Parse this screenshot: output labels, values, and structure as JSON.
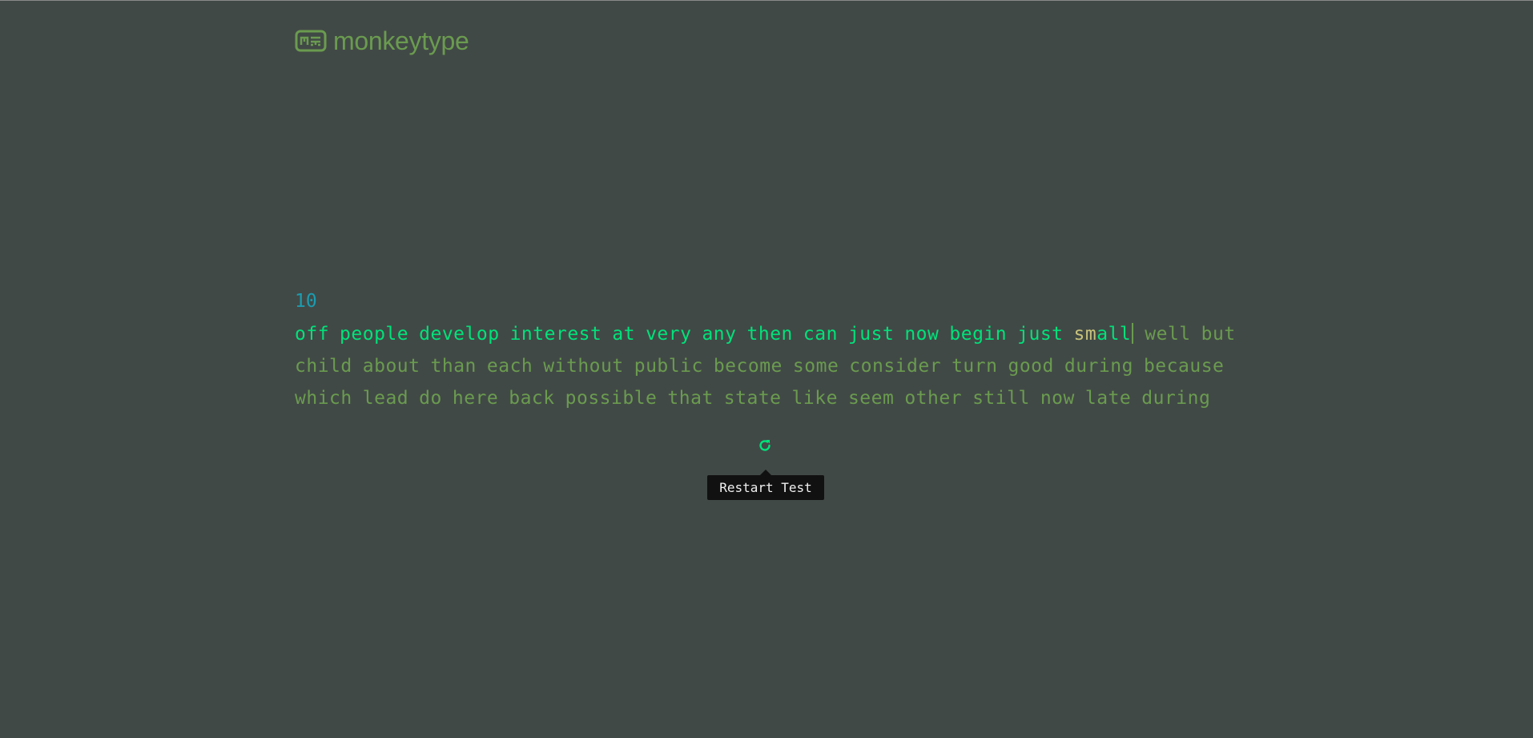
{
  "header": {
    "logo_icon": "keyboard-logo-icon",
    "title": "monkeytype"
  },
  "test": {
    "counter": "10",
    "typed_words": [
      "off",
      "people",
      "develop",
      "interest",
      "at",
      "very",
      "any",
      "then",
      "can",
      "just",
      "now",
      "begin",
      "just"
    ],
    "current_word": {
      "error_part": "sm",
      "correct_part": "all"
    },
    "line1_pending": [
      "well",
      "but"
    ],
    "line2_words": [
      "child",
      "about",
      "than",
      "each",
      "without",
      "public",
      "become",
      "some",
      "consider",
      "turn",
      "good",
      "during",
      "because"
    ],
    "line3_words": [
      "which",
      "lead",
      "do",
      "here",
      "back",
      "possible",
      "that",
      "state",
      "like",
      "seem",
      "other",
      "still",
      "now",
      "late",
      "during"
    ]
  },
  "controls": {
    "restart_icon": "restart-icon",
    "tooltip": "Restart Test"
  },
  "colors": {
    "background": "#414946",
    "typed": "#00e27a",
    "pending": "#6a9b4f",
    "error": "#c8c27a",
    "counter": "#1b9cb0"
  }
}
